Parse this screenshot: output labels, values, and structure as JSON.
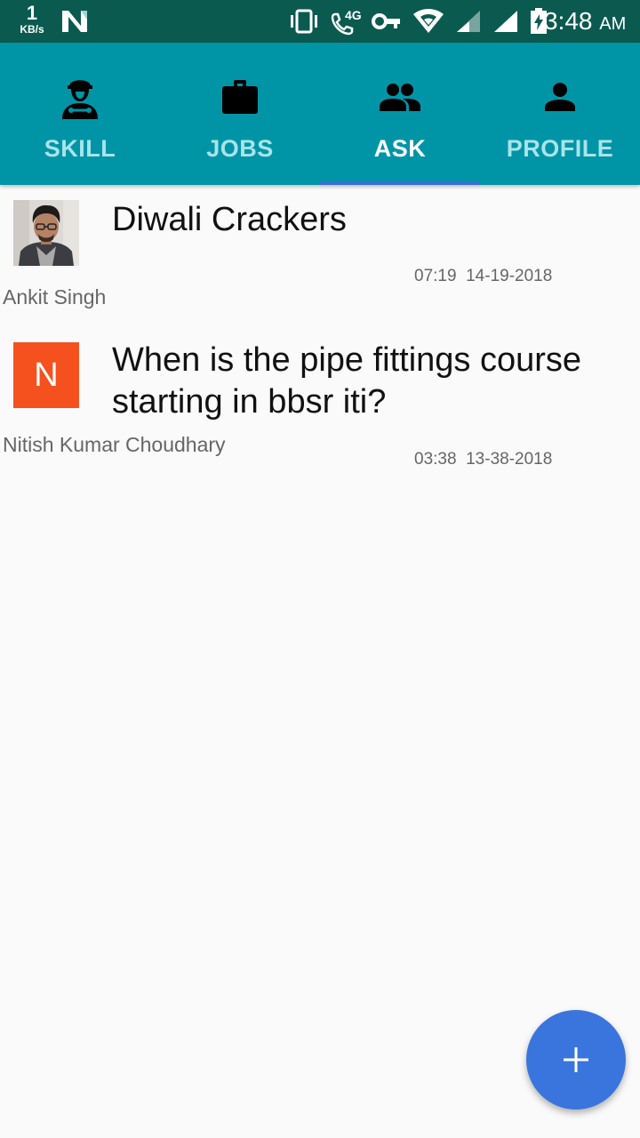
{
  "status_bar": {
    "speed_value": "1",
    "speed_unit": "KB/s",
    "network_type": "4G",
    "time": "3:48",
    "ampm": "AM",
    "icons": [
      "n-logo-icon",
      "vibrate-icon",
      "volte-call-icon",
      "vpn-key-icon",
      "wifi-icon",
      "signal-icon",
      "signal-icon",
      "battery-charging-icon"
    ]
  },
  "tabs": [
    {
      "label": "SKILL",
      "icon": "worker-icon",
      "active": false
    },
    {
      "label": "JOBS",
      "icon": "briefcase-icon",
      "active": false
    },
    {
      "label": "ASK",
      "icon": "people-icon",
      "active": true
    },
    {
      "label": "PROFILE",
      "icon": "person-icon",
      "active": false
    }
  ],
  "posts": [
    {
      "title": "Diwali Crackers",
      "author": "Ankit Singh",
      "time": "07:19",
      "date": "14-19-2018",
      "timestamp": "07:19  14-19-2018",
      "avatar": "photo"
    },
    {
      "title": "When is the pipe fittings course starting in bbsr iti?",
      "author": "Nitish Kumar Choudhary",
      "time": "03:38",
      "date": "13-38-2018",
      "timestamp": "03:38  13-38-2018",
      "avatar_letter": "N"
    }
  ],
  "fab": {
    "icon": "plus-icon"
  },
  "colors": {
    "status_bar": "#0b5a50",
    "tab_bar": "#0095a6",
    "tab_inactive": "#a8e4ea",
    "indicator": "#3a6fd8",
    "fab": "#3a74dd",
    "letter_avatar": "#f4511e"
  }
}
